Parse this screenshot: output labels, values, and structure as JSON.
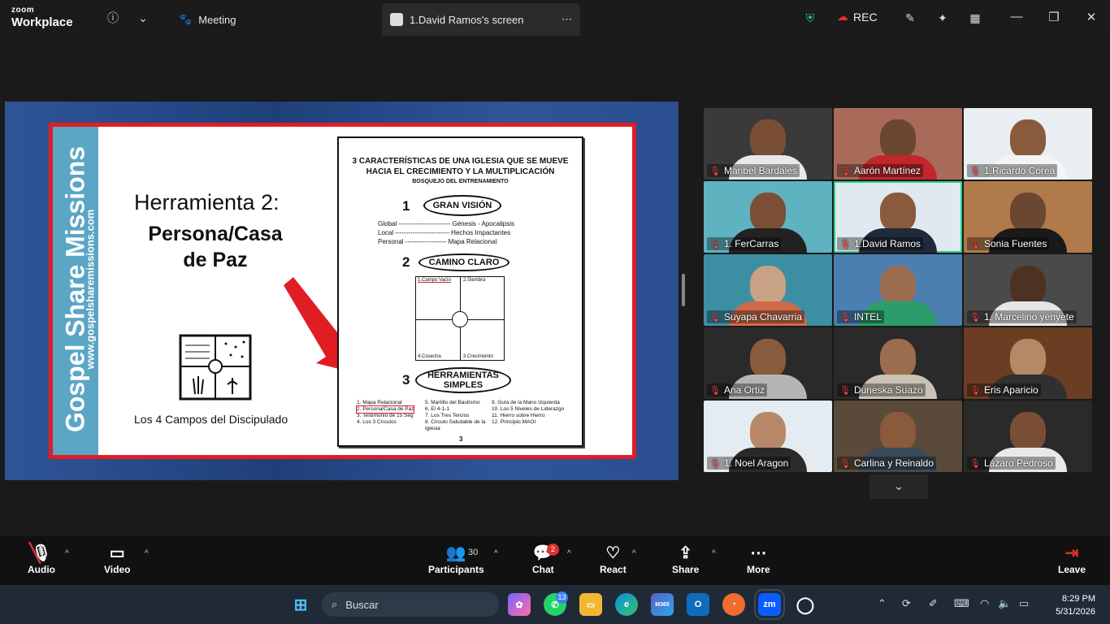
{
  "app": {
    "brand_small": "zoom",
    "brand_big": "Workplace"
  },
  "tabs": [
    {
      "label": "Meeting"
    },
    {
      "label": "1.David Ramos's screen"
    }
  ],
  "recording": {
    "label": "REC"
  },
  "slide": {
    "side_title": "Gospel Share Missions",
    "side_url": "www.gospelsharemissions.com",
    "tool_heading": "Herramienta 2:",
    "main_heading_1": "Persona/Casa",
    "main_heading_2": "de Paz",
    "fields_caption": "Los 4 Campos del Discipulado",
    "doc": {
      "title_1": "3 CARACTERÍSTICAS DE UNA IGLESIA QUE SE MUEVE",
      "title_2": "HACIA EL CRECIMIENTO Y LA MULTIPLICACIÓN",
      "subtitle": "BOSQUEJO DEL ENTRENAMIENTO",
      "n1": "1",
      "vision": "GRAN VISIÓN",
      "list": [
        "Global ------------------------ Génesis - Apocalipsis",
        "Local ------------------------- Hechos Impactantes",
        "Personal ------------------- Mapa Relacional"
      ],
      "n2": "2",
      "camino": "CAMINO CLARO",
      "n3": "3",
      "herr_1": "HERRAMIENTAS",
      "herr_2": "SIMPLES",
      "q1": "1.Campo Vacío",
      "q2": "2.Siembra",
      "q3": "4.Cosecha",
      "q4": "3.Crecimiento",
      "col1": [
        "1. Mapa Relacional",
        "2. Persona/Casa de Paz",
        "3. Testimonio de 15 Seg",
        "4. Los 3 Círculos"
      ],
      "col2": [
        "5. Martillo del Bautismo",
        "6. El 4-1-1",
        "7. Los Tres Tercios",
        "8. Círculo Saludable de la Iglesia"
      ],
      "col3": [
        "9. Guía de la Mano Izquierda",
        "10. Los 5 Niveles de Liderazgo",
        "11. Hierro sobre Hierro",
        "12. Principio MAOI"
      ],
      "page": "3"
    }
  },
  "participants": [
    {
      "name": "Maribel Bardales",
      "bg": "#3a3a3a",
      "skin": "#7a4e36",
      "shirt": "#e8e8e8"
    },
    {
      "name": "Aarón Martínez",
      "bg": "#a96a5a",
      "skin": "#6b4630",
      "shirt": "#c0262c"
    },
    {
      "name": "1.Ricardo Corea",
      "bg": "#e9eef2",
      "skin": "#8a5a3c",
      "shirt": "#f4f4f4"
    },
    {
      "name": "1. FerCarras",
      "bg": "#5fb3c0",
      "skin": "#7b4f34",
      "shirt": "#222"
    },
    {
      "name": "1.David Ramos",
      "bg": "#dfe9ef",
      "skin": "#8a5a3c",
      "shirt": "#1f2a3a"
    },
    {
      "name": "Sonia Fuentes",
      "bg": "#b07a4a",
      "skin": "#6b4630",
      "shirt": "#1a1a1a"
    },
    {
      "name": "Suyapa Chavarria",
      "bg": "#3c8fa3",
      "skin": "#c9a184",
      "shirt": "#d06a4a"
    },
    {
      "name": "INTEL",
      "bg": "#4a7fb0",
      "skin": "#9b6d4e",
      "shirt": "#2a9d6a"
    },
    {
      "name": "1. Marcelino yenyete",
      "bg": "#4a4a4a",
      "skin": "#4d3222",
      "shirt": "#e6e6e6"
    },
    {
      "name": "Ana Ortiz",
      "bg": "#2a2a2a",
      "skin": "#8a5a3c",
      "shirt": "#b5b5b5"
    },
    {
      "name": "Duneska Suazo",
      "bg": "#2a2a2a",
      "skin": "#9b6d4e",
      "shirt": "#c9c2b5"
    },
    {
      "name": "Eris Aparicio",
      "bg": "#6b3d22",
      "skin": "#b58966",
      "shirt": "#303030"
    },
    {
      "name": "1. Noel Aragon",
      "bg": "#e4ecf1",
      "skin": "#b8876a",
      "shirt": "#2a2a2a"
    },
    {
      "name": "Carlina y Reinaldo",
      "bg": "#5a4a3a",
      "skin": "#8a5a3c",
      "shirt": "#3b4a5a"
    },
    {
      "name": "Lázaro Pedroso",
      "bg": "#2a2a2a",
      "skin": "#7a4e36",
      "shirt": "#e8e8e8"
    }
  ],
  "toolbar": {
    "audio": "Audio",
    "video": "Video",
    "participants": "Participants",
    "participants_count": "30",
    "chat": "Chat",
    "chat_badge": "2",
    "react": "React",
    "share": "Share",
    "more": "More",
    "leave": "Leave"
  },
  "taskbar": {
    "search_placeholder": "Buscar",
    "whatsapp_badge": "13",
    "m365": "M365",
    "zoom": "zm",
    "time": "8:29 PM",
    "date": "5/31/2026"
  }
}
